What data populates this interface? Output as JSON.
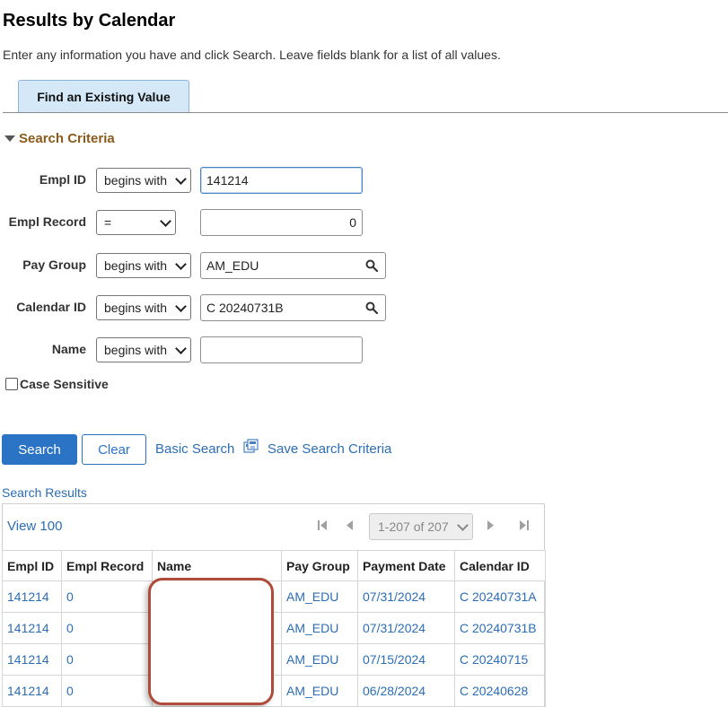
{
  "page": {
    "title": "Results by Calendar",
    "instructions": "Enter any information you have and click Search. Leave fields blank for a list of all values."
  },
  "tab": {
    "label": "Find an Existing Value"
  },
  "search_criteria": {
    "header": "Search Criteria",
    "fields": [
      {
        "label": "Empl ID",
        "operator": "begins with",
        "value": "141214"
      },
      {
        "label": "Empl Record",
        "operator": "=",
        "value": "0"
      },
      {
        "label": "Pay Group",
        "operator": "begins with",
        "value": "AM_EDU"
      },
      {
        "label": "Calendar ID",
        "operator": "begins with",
        "value": "C 20240731B"
      },
      {
        "label": "Name",
        "operator": "begins with",
        "value": ""
      }
    ],
    "case_sensitive": {
      "label": "Case Sensitive",
      "checked": false
    }
  },
  "actions": {
    "search": "Search",
    "clear": "Clear",
    "basic_search": "Basic Search",
    "save_criteria": "Save Search Criteria"
  },
  "results": {
    "title": "Search Results",
    "view_all": "View 100",
    "pager": "1-207 of 207",
    "columns": [
      "Empl ID",
      "Empl Record",
      "Name",
      "Pay Group",
      "Payment Date",
      "Calendar ID"
    ],
    "rows": [
      [
        "141214",
        "0",
        "",
        "AM_EDU",
        "07/31/2024",
        "C 20240731A"
      ],
      [
        "141214",
        "0",
        "",
        "AM_EDU",
        "07/31/2024",
        "C 20240731B"
      ],
      [
        "141214",
        "0",
        "",
        "AM_EDU",
        "07/15/2024",
        "C 20240715"
      ],
      [
        "141214",
        "0",
        "",
        "AM_EDU",
        "06/28/2024",
        "C 20240628"
      ]
    ]
  },
  "colors": {
    "accent": "#2b73c4",
    "section_header": "#8a5a1c",
    "tab_bg": "#d5e8f7",
    "redaction_border": "#b04a3a"
  }
}
